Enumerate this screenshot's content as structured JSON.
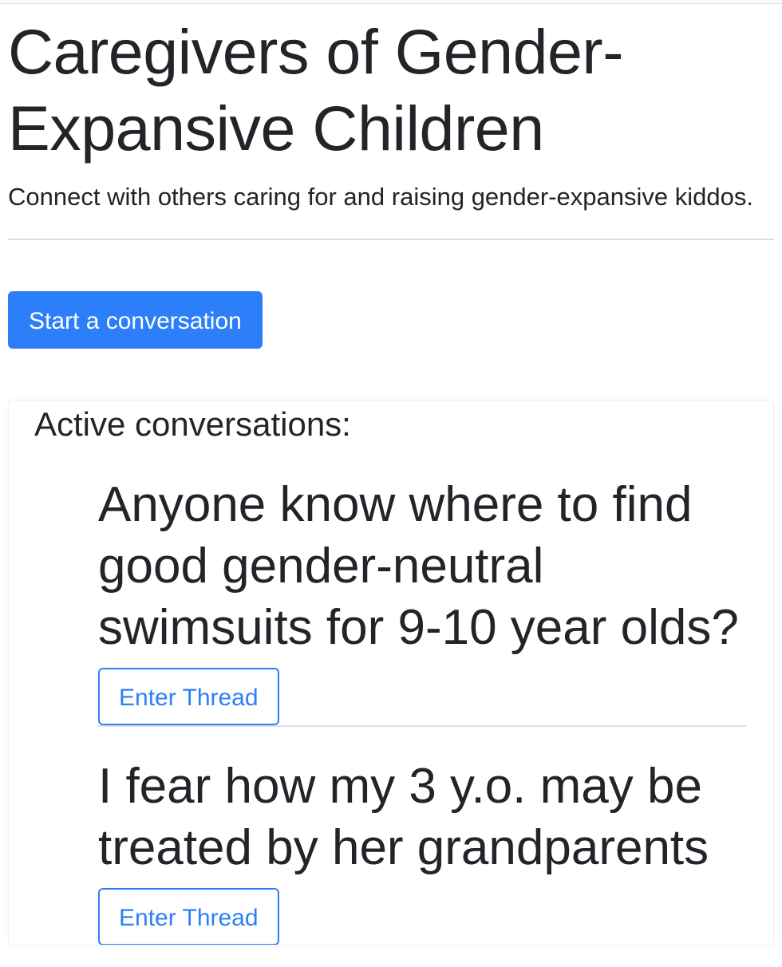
{
  "header": {
    "title": "Caregivers of Gender-Expansive Children",
    "title_line1": "Caregivers of Gender-",
    "title_line2": "Expansive Children",
    "lead": "Connect with others caring for and raising gender-expansive kiddos."
  },
  "actions": {
    "start_conversation_label": "Start a conversation"
  },
  "conversations": {
    "heading": "Active conversations:",
    "threads": [
      {
        "title": "Anyone know where to find good gender-neutral swimsuits for 9-10 year olds?",
        "button_label": "Enter Thread"
      },
      {
        "title": "I fear how my 3 y.o. may be treated by her grandparents",
        "button_label": "Enter Thread"
      }
    ]
  },
  "colors": {
    "primary": "#2d7ff9",
    "text": "#212529",
    "divider": "#dcdcdc"
  }
}
